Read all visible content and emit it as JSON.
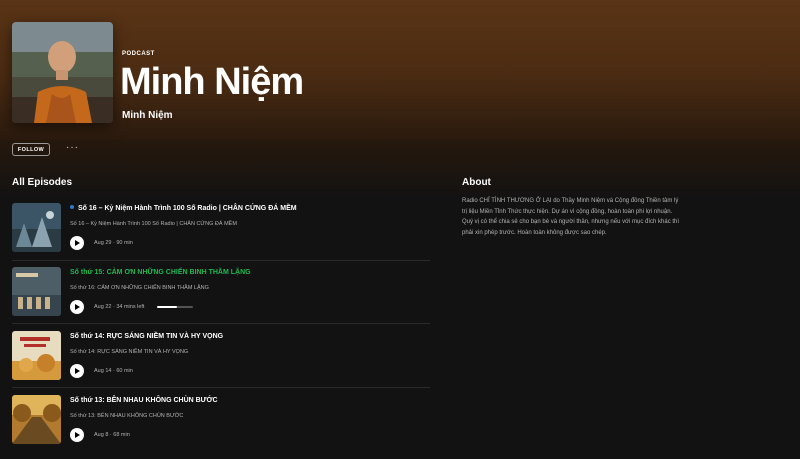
{
  "header": {
    "kicker": "PODCAST",
    "title": "Minh Niệm",
    "author": "Minh Niệm",
    "follow_label": "FOLLOW",
    "more_label": "···"
  },
  "sections": {
    "episodes_title": "All Episodes",
    "about_title": "About"
  },
  "about": {
    "text": "Radio CHỈ TÌNH THƯƠNG Ở LẠI do Thầy Minh Niệm và Cộng đồng Thiền tâm lý trị liệu Miền Tỉnh Thức thực hiện. Dự án vì cộng đồng, hoàn toàn phi lợi nhuận. Quý vị có thể chia sẻ cho bạn bè và người thân, nhưng nếu với mục đích khác thì phải xin phép trước. Hoàn toàn không được sao chép."
  },
  "colors": {
    "accent_green": "#1db954",
    "new_dot_blue": "#2e77d0",
    "hero_brown": "#5a3416"
  },
  "episodes": [
    {
      "title": "Số 16 – Kỷ Niệm Hành Trình 100 Số Radio | CHÂN CỨNG ĐÁ MỀM",
      "description": "Số 16 – Kỷ Niệm Hành Trình 100 Số Radio | CHÂN CỨNG ĐÁ MỀM",
      "meta": "Aug 29 · 90 min",
      "is_new": true,
      "is_playing": false
    },
    {
      "title": "Số thứ 15: CẢM ƠN NHỮNG CHIẾN BINH THẦM LẶNG",
      "description": "Số thứ 16: CẢM ƠN NHỮNG CHIẾN BINH THẦM LẶNG",
      "meta": "Aug 22 · 34 mins left",
      "progress": 0.55,
      "is_playing": true
    },
    {
      "title": "Số thứ 14: RỰC SÁNG NIỀM TIN VÀ HY VỌNG",
      "description": "Số thứ 14: RỰC SÁNG NIỀM TIN VÀ HY VỌNG",
      "meta": "Aug 14 · 60 min"
    },
    {
      "title": "Số thứ 13: BÊN NHAU KHÔNG CHÙN BƯỚC",
      "description": "Số thứ 13: BÊN NHAU KHÔNG CHÙN BƯỚC",
      "meta": "Aug 8 · 68 min"
    }
  ]
}
